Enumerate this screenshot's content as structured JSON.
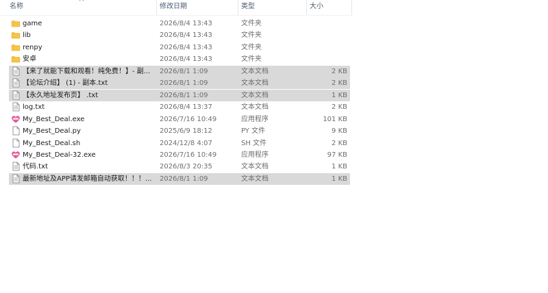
{
  "header": {
    "name_label": "名称",
    "date_label": "修改日期",
    "type_label": "类型",
    "size_label": "大小"
  },
  "files": [
    {
      "name": "game",
      "date": "2026/8/4 13:43",
      "type": "文件夹",
      "size": "",
      "icon": "folder-icon",
      "selected": false
    },
    {
      "name": "lib",
      "date": "2026/8/4 13:43",
      "type": "文件夹",
      "size": "",
      "icon": "folder-icon",
      "selected": false
    },
    {
      "name": "renpy",
      "date": "2026/8/4 13:43",
      "type": "文件夹",
      "size": "",
      "icon": "folder-icon",
      "selected": false
    },
    {
      "name": "安卓",
      "date": "2026/8/4 13:43",
      "type": "文件夹",
      "size": "",
      "icon": "folder-icon",
      "selected": false
    },
    {
      "name": "【来了就能下载和观看！纯免费！】- 副...",
      "date": "2026/8/1 1:09",
      "type": "文本文档",
      "size": "2 KB",
      "icon": "text-file-icon",
      "selected": true
    },
    {
      "name": "【论坛介绍】 (1) - 副本.txt",
      "date": "2026/8/1 1:09",
      "type": "文本文档",
      "size": "2 KB",
      "icon": "text-file-icon",
      "selected": true
    },
    {
      "name": "【永久地址发布页】 .txt",
      "date": "2026/8/1 1:09",
      "type": "文本文档",
      "size": "1 KB",
      "icon": "text-file-icon",
      "selected": true
    },
    {
      "name": "log.txt",
      "date": "2026/8/4 13:37",
      "type": "文本文档",
      "size": "2 KB",
      "icon": "text-file-icon",
      "selected": false
    },
    {
      "name": "My_Best_Deal.exe",
      "date": "2026/7/16 10:49",
      "type": "应用程序",
      "size": "101 KB",
      "icon": "heart-app-icon",
      "selected": false
    },
    {
      "name": "My_Best_Deal.py",
      "date": "2025/6/9 18:12",
      "type": "PY 文件",
      "size": "9 KB",
      "icon": "blank-file-icon",
      "selected": false
    },
    {
      "name": "My_Best_Deal.sh",
      "date": "2024/12/8 4:07",
      "type": "SH 文件",
      "size": "2 KB",
      "icon": "blank-file-icon",
      "selected": false
    },
    {
      "name": "My_Best_Deal-32.exe",
      "date": "2026/7/16 10:49",
      "type": "应用程序",
      "size": "97 KB",
      "icon": "heart-app-icon",
      "selected": false
    },
    {
      "name": "代码.txt",
      "date": "2026/8/3 20:35",
      "type": "文本文档",
      "size": "1 KB",
      "icon": "text-file-icon",
      "selected": false
    },
    {
      "name": "最新地址及APP请发邮箱自动获取！！！...",
      "date": "2026/8/1 1:09",
      "type": "文本文档",
      "size": "1 KB",
      "icon": "text-file-icon",
      "selected": true
    }
  ],
  "colors": {
    "folder": "#f5c54a",
    "folder_dark": "#e6a92a",
    "selection": "#d9d9d9",
    "heart": "#e05a9a"
  }
}
